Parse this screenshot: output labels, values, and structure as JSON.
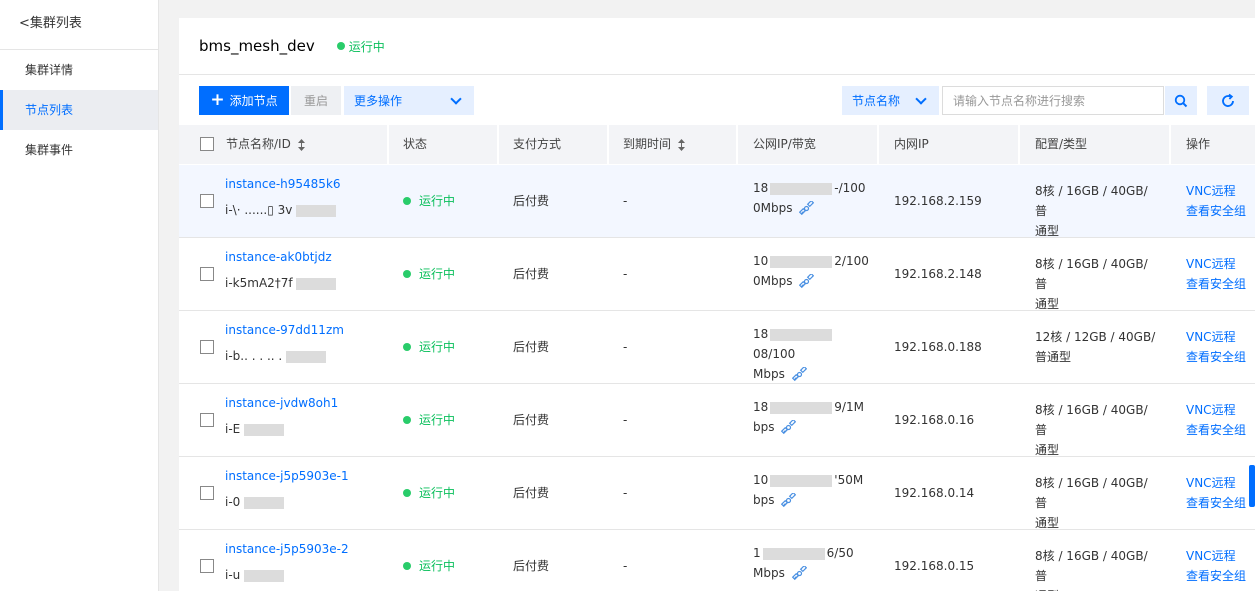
{
  "sidebar": {
    "back_label": "<集群列表",
    "items": [
      {
        "label": "集群详情",
        "active": false
      },
      {
        "label": "节点列表",
        "active": true
      },
      {
        "label": "集群事件",
        "active": false
      }
    ]
  },
  "header": {
    "cluster_name": "bms_mesh_dev",
    "status": "运行中",
    "status_color": "#0abf5b"
  },
  "toolbar": {
    "add_label": "添加节点",
    "restart_label": "重启",
    "more_label": "更多操作",
    "search_field_label": "节点名称",
    "search_placeholder": "请输入节点名称进行搜索"
  },
  "table": {
    "columns": [
      "节点名称/ID",
      "状态",
      "支付方式",
      "到期时间",
      "公网IP/带宽",
      "内网IP",
      "配置/类型",
      "操作"
    ],
    "rows": [
      {
        "name": "instance-h95485k6",
        "id": "i-\\· ......▯ 3v",
        "status": "运行中",
        "payment": "后付费",
        "expire": "-",
        "ip_a": "18",
        "ip_b": "-/100",
        "ip_c": "0Mbps",
        "private_ip": "192.168.2.159",
        "config_a": "8核 / 16GB / 40GB/ 普",
        "config_b": "通型",
        "op_vnc": "VNC远程",
        "op_sg": "查看安全组"
      },
      {
        "name": "instance-ak0btjdz",
        "id": "i-k5mA2†7f",
        "status": "运行中",
        "payment": "后付费",
        "expire": "-",
        "ip_a": "10",
        "ip_b": "2/100",
        "ip_c": "0Mbps",
        "private_ip": "192.168.2.148",
        "config_a": "8核 / 16GB / 40GB/ 普",
        "config_b": "通型",
        "op_vnc": "VNC远程",
        "op_sg": "查看安全组"
      },
      {
        "name": "instance-97dd11zm",
        "id": "i-b.. . . .. .",
        "status": "运行中",
        "payment": "后付费",
        "expire": "-",
        "ip_a": "18",
        "ip_b": "08/100",
        "ip_c": "Mbps",
        "private_ip": "192.168.0.188",
        "config_a": "12核 / 12GB / 40GB/",
        "config_b": "普通型",
        "op_vnc": "VNC远程",
        "op_sg": "查看安全组"
      },
      {
        "name": "instance-jvdw8oh1",
        "id": "i-E",
        "status": "运行中",
        "payment": "后付费",
        "expire": "-",
        "ip_a": "18",
        "ip_b": "9/1M",
        "ip_c": "bps",
        "private_ip": "192.168.0.16",
        "config_a": "8核 / 16GB / 40GB/ 普",
        "config_b": "通型",
        "op_vnc": "VNC远程",
        "op_sg": "查看安全组"
      },
      {
        "name": "instance-j5p5903e-1",
        "id": "i-0",
        "status": "运行中",
        "payment": "后付费",
        "expire": "-",
        "ip_a": "10",
        "ip_b": "'50M",
        "ip_c": "bps",
        "private_ip": "192.168.0.14",
        "config_a": "8核 / 16GB / 40GB/ 普",
        "config_b": "通型",
        "op_vnc": "VNC远程",
        "op_sg": "查看安全组"
      },
      {
        "name": "instance-j5p5903e-2",
        "id": "i-u",
        "status": "运行中",
        "payment": "后付费",
        "expire": "-",
        "ip_a": "1",
        "ip_b": "6/50",
        "ip_c": "Mbps",
        "private_ip": "192.168.0.15",
        "config_a": "8核 / 16GB / 40GB/ 普",
        "config_b": "通型",
        "op_vnc": "VNC远程",
        "op_sg": "查看安全组"
      }
    ]
  },
  "colors": {
    "accent": "#006eff",
    "running": "#0abf5b"
  }
}
